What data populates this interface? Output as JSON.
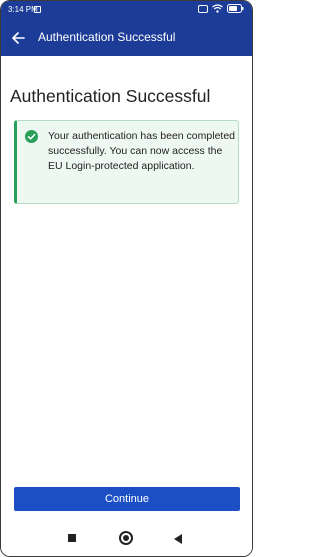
{
  "status_bar": {
    "time": "3:14 PM",
    "icons": [
      "notification-icon",
      "screen-record-icon",
      "wifi-icon",
      "battery-icon"
    ]
  },
  "app_bar": {
    "title": "Authentication Successful",
    "back_icon": "back-arrow-icon"
  },
  "main": {
    "heading": "Authentication Successful",
    "alert": {
      "icon": "check-circle-icon",
      "message": "Your authentication has been completed successfully. You can now access the EU Login-protected application."
    },
    "continue_label": "Continue"
  },
  "nav_bar": {
    "items": [
      "recents-icon",
      "home-icon",
      "back-icon"
    ]
  },
  "colors": {
    "brand": "#1c3c97",
    "button": "#1c4fc4",
    "success": "#28a05a",
    "success_bg": "#eef8f2"
  }
}
